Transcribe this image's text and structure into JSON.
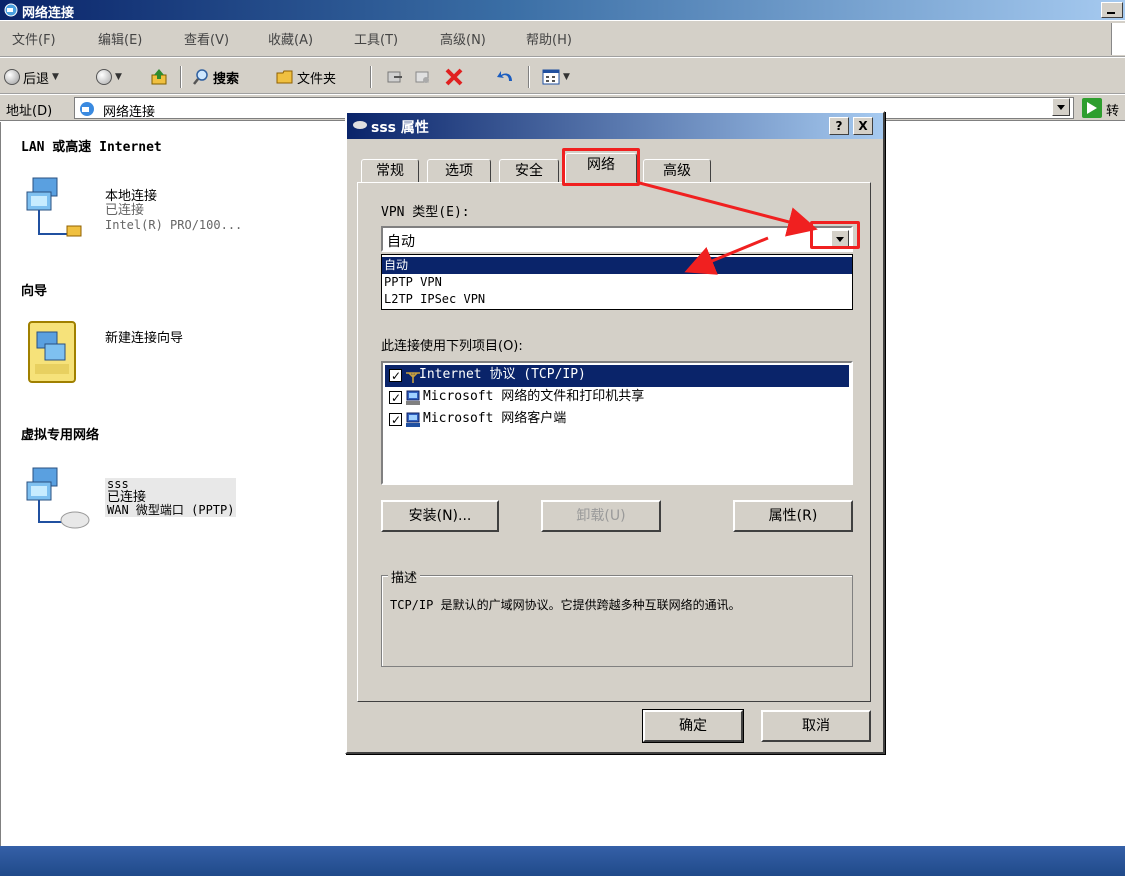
{
  "window": {
    "title": "网络连接"
  },
  "menu": [
    "文件(F)",
    "编辑(E)",
    "查看(V)",
    "收藏(A)",
    "工具(T)",
    "高级(N)",
    "帮助(H)"
  ],
  "toolbar": {
    "back": "后退",
    "search": "搜索",
    "folders": "文件夹"
  },
  "address": {
    "label": "地址(D)",
    "value": "网络连接",
    "go": "转"
  },
  "sections": {
    "lan": "LAN 或高速 Internet",
    "wizard": "向导",
    "vpn": "虚拟专用网络"
  },
  "connections": {
    "local": {
      "name": "本地连接",
      "status": "已连接",
      "device": "Intel(R) PRO/100..."
    },
    "wizard": {
      "name": "新建连接向导"
    },
    "sss": {
      "name": "sss",
      "status": "已连接",
      "device": "WAN 微型端口 (PPTP)"
    }
  },
  "dialog": {
    "title": "sss 属性",
    "help_btn": "?",
    "close_btn": "X",
    "tabs": [
      "常规",
      "选项",
      "安全",
      "网络",
      "高级"
    ],
    "active_tab": "网络",
    "vpn_type_label": "VPN 类型(E):",
    "vpn_type_value": "自动",
    "vpn_options": [
      "自动",
      "PPTP VPN",
      "L2TP IPSec VPN"
    ],
    "items_label": "此连接使用下列项目(O):",
    "items": [
      {
        "label": "Internet 协议 (TCP/IP)",
        "checked": true,
        "icon": "protocol-icon"
      },
      {
        "label": "Microsoft 网络的文件和打印机共享",
        "checked": true,
        "icon": "printer-share-icon"
      },
      {
        "label": "Microsoft 网络客户端",
        "checked": true,
        "icon": "network-client-icon"
      }
    ],
    "install_btn": "安装(N)...",
    "uninstall_btn": "卸载(U)",
    "properties_btn": "属性(R)",
    "description_title": "描述",
    "description_text": "TCP/IP 是默认的广域网协议。它提供跨越多种互联网络的通讯。",
    "ok_btn": "确定",
    "cancel_btn": "取消"
  },
  "colors": {
    "title_active": "#0a246a",
    "face": "#d4d0c8",
    "selection": "#0a246a",
    "annotation": "#f02020"
  }
}
